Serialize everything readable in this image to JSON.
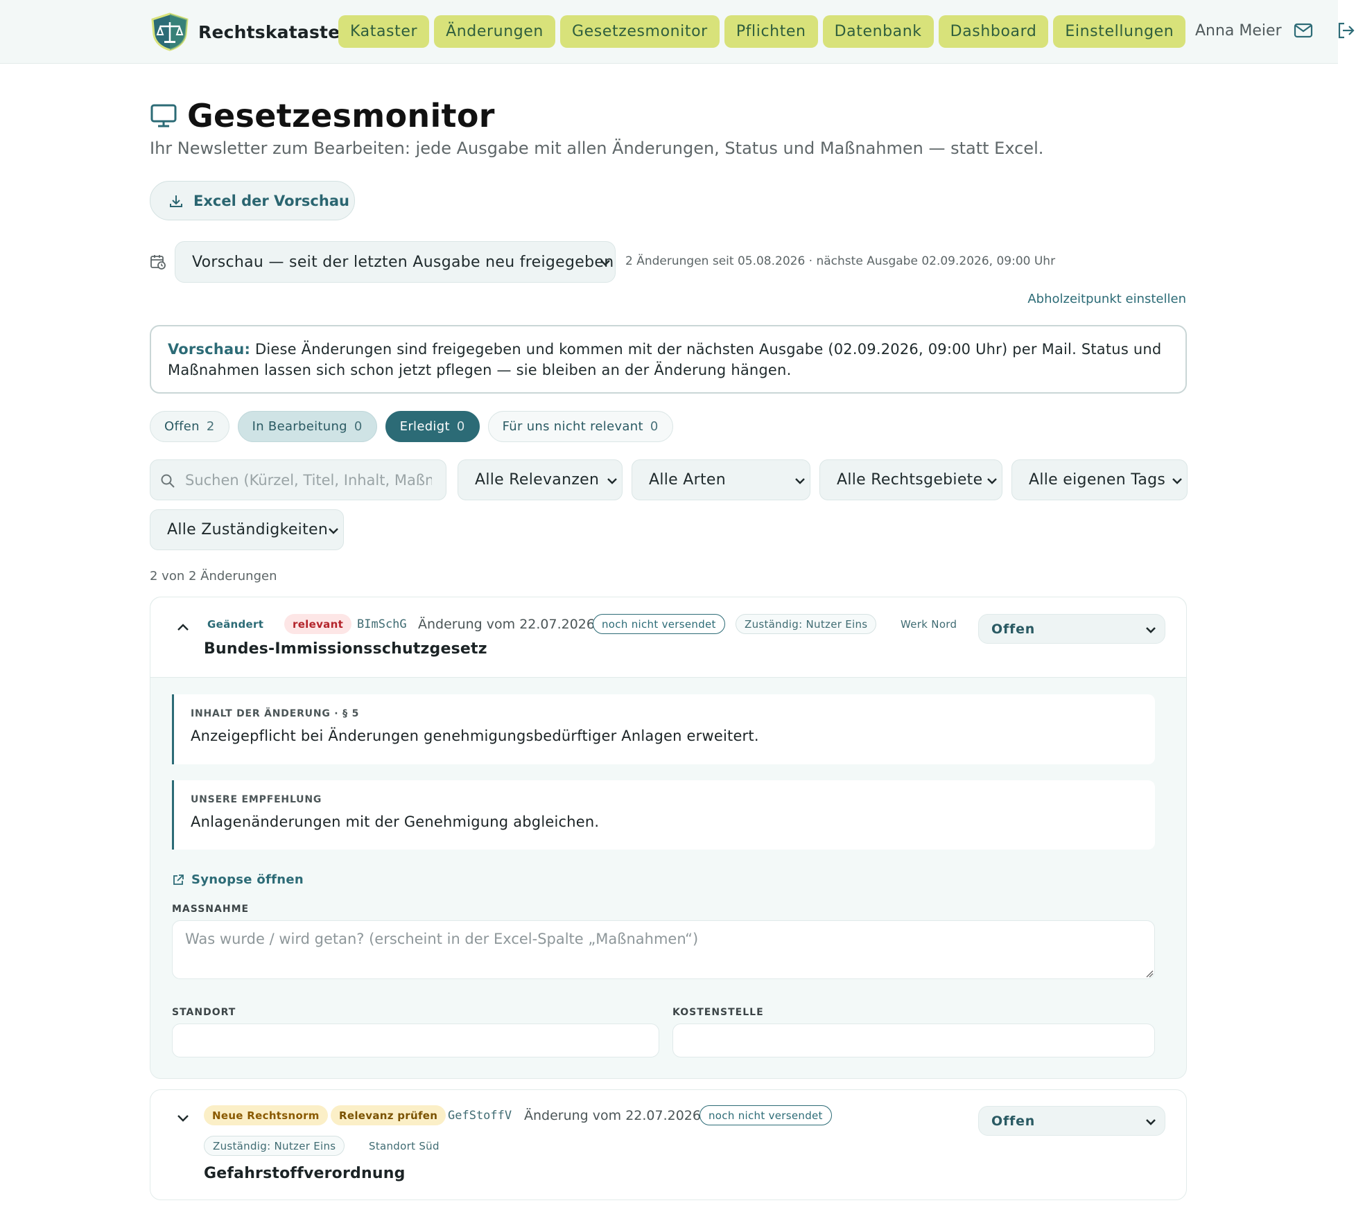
{
  "brand": {
    "name": "Rechtskataster"
  },
  "nav": {
    "items": [
      "Kataster",
      "Änderungen",
      "Gesetzesmonitor",
      "Pflichten",
      "Datenbank",
      "Dashboard",
      "Einstellungen"
    ]
  },
  "user": {
    "name": "Anna Meier"
  },
  "page": {
    "title": "Gesetzesmonitor",
    "subtitle": "Ihr Newsletter zum Bearbeiten: jede Ausgabe mit allen Änderungen, Status und Maßnahmen — statt Excel.",
    "excel_button": "Excel der Vorschau"
  },
  "issue": {
    "selected": "Vorschau — seit der letzten Ausgabe neu freigegeben",
    "meta": "2 Änderungen seit 05.08.2026 · nächste Ausgabe 02.09.2026, 09:00 Uhr",
    "pickup_link": "Abholzeitpunkt einstellen"
  },
  "info": {
    "lead": "Vorschau:",
    "text": " Diese Änderungen sind freigegeben und kommen mit der nächsten Ausgabe (02.09.2026, 09:00 Uhr) per Mail. Status und Maßnahmen lassen sich schon jetzt pflegen — sie bleiben an der Änderung hängen."
  },
  "status_tabs": [
    {
      "label": "Offen",
      "count": "2"
    },
    {
      "label": "In Bearbeitung",
      "count": "0"
    },
    {
      "label": "Erledigt",
      "count": "0"
    },
    {
      "label": "Für uns nicht relevant",
      "count": "0"
    }
  ],
  "filters": {
    "search_placeholder": "Suchen (Kürzel, Titel, Inhalt, Maßnahme)",
    "relevance": "Alle Relevanzen",
    "types": "Alle Arten",
    "legal_areas": "Alle Rechtsgebiete",
    "tags": "Alle eigenen Tags",
    "responsibilities": "Alle Zuständigkeiten"
  },
  "result_count": "2 von 2 Änderungen",
  "changes": [
    {
      "type_badge": "Geändert",
      "relevance_badge": "relevant",
      "abbr": "BImSchG",
      "date": "Änderung vom 22.07.2026",
      "sent_badge": "noch nicht versendet",
      "responsible": "Zuständig: Nutzer Eins",
      "site": "Werk Nord",
      "title": "Bundes-Immissionsschutzgesetz",
      "status": "Offen",
      "content_label": "INHALT DER ÄNDERUNG · § 5",
      "content_text": "Anzeigepflicht bei Änderungen genehmigungsbedürftiger Anlagen erweitert.",
      "recommendation_label": "UNSERE EMPFEHLUNG",
      "recommendation_text": "Anlagenänderungen mit der Genehmigung abgleichen.",
      "synopse_link": "Synopse öffnen",
      "measure_label": "MASSNAHME",
      "measure_placeholder": "Was wurde / wird getan? (erscheint in der Excel-Spalte „Maßnahmen“)",
      "location_label": "STANDORT",
      "cost_center_label": "KOSTENSTELLE"
    },
    {
      "type_badge": "Neue Rechtsnorm",
      "relevance_badge": "Relevanz prüfen",
      "abbr": "GefStoffV",
      "date": "Änderung vom 22.07.2026",
      "sent_badge": "noch nicht versendet",
      "responsible": "Zuständig: Nutzer Eins",
      "site": "Standort Süd",
      "title": "Gefahrstoffverordnung",
      "status": "Offen"
    }
  ],
  "colors": {
    "accent": "#2c6b76",
    "nav_button": "#d8e27a",
    "relevant": "#b4252c",
    "warning_bg": "#fbefc7"
  }
}
